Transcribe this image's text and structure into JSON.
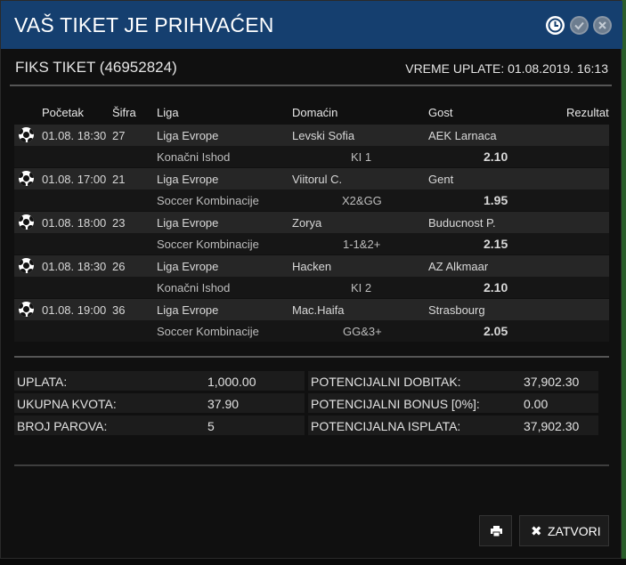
{
  "dialog": {
    "title": "VAŠ TIKET JE PRIHVAĆEN"
  },
  "ticket": {
    "title": "FIKS TIKET (46952824)",
    "payment_time": "VREME UPLATE: 01.08.2019. 16:13"
  },
  "columns": {
    "start": "Početak",
    "code": "Šifra",
    "league": "Liga",
    "home": "Domaćin",
    "away": "Gost",
    "result": "Rezultat"
  },
  "matches": [
    {
      "start": "01.08. 18:30",
      "code": "27",
      "league": "Liga Evrope",
      "home": "Levski Sofia",
      "away": "AEK Larnaca",
      "bet_type": "Konačni Ishod",
      "tip": "KI 1",
      "odd": "2.10"
    },
    {
      "start": "01.08. 17:00",
      "code": "21",
      "league": "Liga Evrope",
      "home": "Viitorul C.",
      "away": "Gent",
      "bet_type": "Soccer Kombinacije",
      "tip": "X2&GG",
      "odd": "1.95"
    },
    {
      "start": "01.08. 18:00",
      "code": "23",
      "league": "Liga Evrope",
      "home": "Zorya",
      "away": "Buducnost P.",
      "bet_type": "Soccer Kombinacije",
      "tip": "1-1&2+",
      "odd": "2.15"
    },
    {
      "start": "01.08. 18:30",
      "code": "26",
      "league": "Liga Evrope",
      "home": "Hacken",
      "away": "AZ Alkmaar",
      "bet_type": "Konačni Ishod",
      "tip": "KI 2",
      "odd": "2.10"
    },
    {
      "start": "01.08. 19:00",
      "code": "36",
      "league": "Liga Evrope",
      "home": "Mac.Haifa",
      "away": "Strasbourg",
      "bet_type": "Soccer Kombinacije",
      "tip": "GG&3+",
      "odd": "2.05"
    }
  ],
  "summary": {
    "stake_label": "UPLATA:",
    "stake_value": "1,000.00",
    "total_odds_label": "UKUPNA KVOTA:",
    "total_odds_value": "37.90",
    "pairs_label": "BROJ PAROVA:",
    "pairs_value": "5",
    "potential_win_label": "POTENCIJALNI DOBITAK:",
    "potential_win_value": "37,902.30",
    "potential_bonus_label": "POTENCIJALNI BONUS [0%]:",
    "potential_bonus_value": "0.00",
    "potential_payout_label": "POTENCIJALNA ISPLATA:",
    "potential_payout_value": "37,902.30"
  },
  "buttons": {
    "close_label": "ZATVORI"
  },
  "icons": {
    "header": [
      "clock-icon",
      "check-icon",
      "close-icon"
    ],
    "row": "soccer-ball-icon",
    "print": "printer-icon"
  },
  "colors": {
    "header_bg": "#153f6f",
    "row_bg": "#262626"
  }
}
